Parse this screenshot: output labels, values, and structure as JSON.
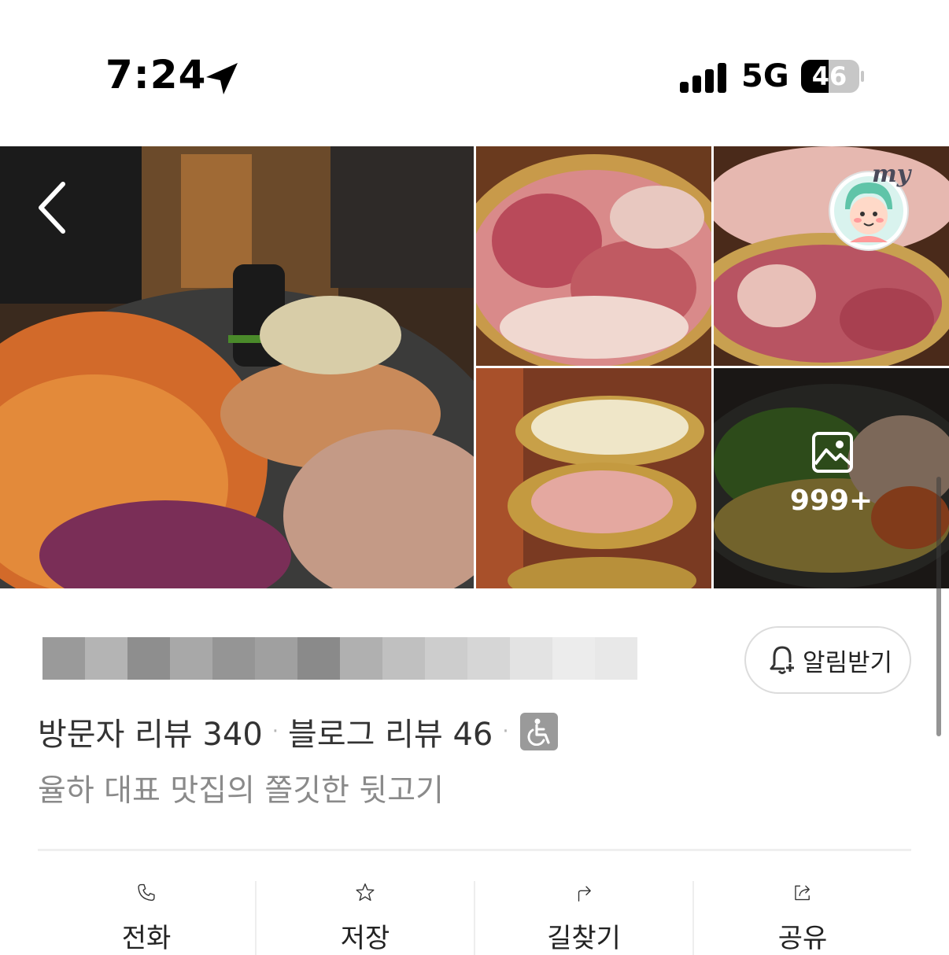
{
  "status_bar": {
    "time": "7:24",
    "network": "5G",
    "battery": "46"
  },
  "gallery": {
    "more_count": "999+",
    "badge_text": "my"
  },
  "place": {
    "alarm_button_label": "알림받기",
    "visitor_reviews": "방문자 리뷰 340",
    "blog_reviews": "블로그 리뷰 46",
    "separator": "·",
    "tagline": "율하 대표 맛집의 쫄깃한 뒷고기"
  },
  "actions": [
    {
      "label": "전화",
      "icon": "phone-icon"
    },
    {
      "label": "저장",
      "icon": "star-icon"
    },
    {
      "label": "길찾기",
      "icon": "directions-icon"
    },
    {
      "label": "공유",
      "icon": "share-icon"
    }
  ],
  "colors": {
    "accent_gray": "#9a9a9a",
    "divider": "#efefef",
    "subtext": "#8a8a8a"
  }
}
